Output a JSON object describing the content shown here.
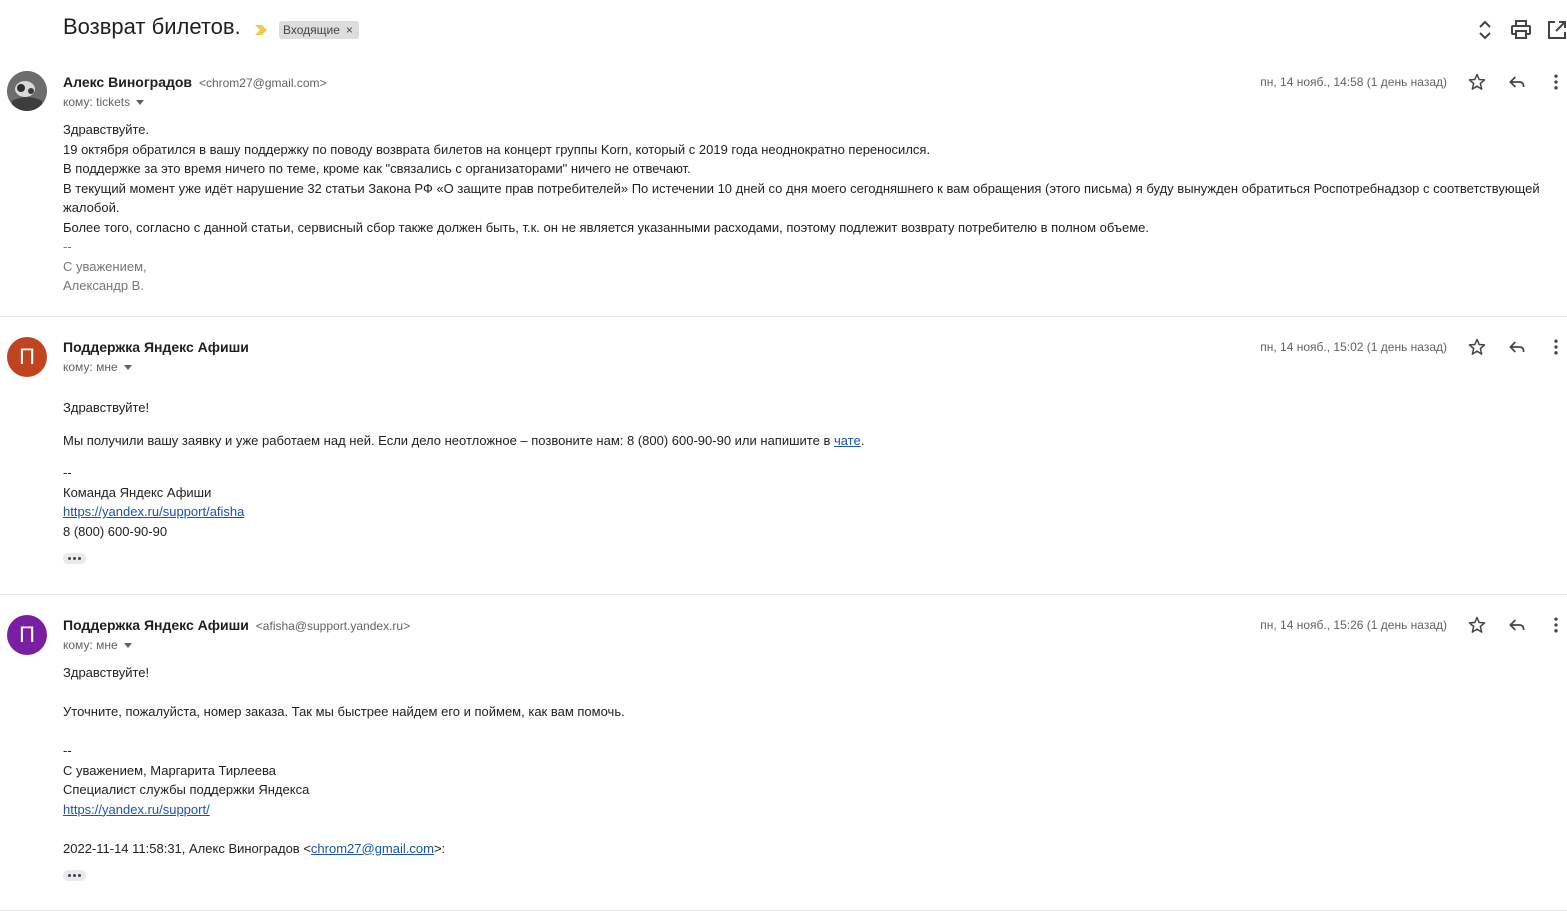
{
  "thread": {
    "subject": "Возврат билетов.",
    "label": "Входящие",
    "label_remove": "×",
    "important_color": "#f2c94c"
  },
  "messages": [
    {
      "sender_name": "Алекс Виноградов",
      "sender_email": "<chrom27@gmail.com>",
      "to": "кому: tickets",
      "date": "пн, 14 нояб., 14:58 (1 день назад)",
      "avatar_type": "photo",
      "body": [
        "Здравствуйте.",
        "19 октября обратился в вашу поддержку по поводу возврата билетов на концерт группы Korn, который с 2019 года неоднократно переносился.",
        "В поддержке за это время ничего по теме, кроме как \"связались с организаторами\" ничего не отвечают.",
        "В текущий момент уже идёт нарушение 32 статьи Закона РФ «О защите прав потребителей» По истечении 10 дней со дня моего сегодняшнего к вам обращения (этого письма) я буду вынужден обратиться Роспотребнадзор с соответствующей жалобой.",
        "Более того, согласно с данной статьи, сервисный сбор также должен быть, т.к. он не является указанными расходами, поэтому подлежит возврату потребителю в полном объеме."
      ],
      "signature": [
        "--",
        "С уважением,",
        "Александр В."
      ]
    },
    {
      "sender_name": "Поддержка Яндекс Афиши",
      "sender_email": "",
      "to": "кому: мне",
      "date": "пн, 14 нояб., 15:02 (1 день назад)",
      "avatar_letter": "П",
      "avatar_color": "#c0441e",
      "greeting": "Здравствуйте!",
      "text": "Мы получили вашу заявку и уже работаем над ней. Если дело неотложное – позвоните нам: 8 (800) 600-90-90 или напишите в ",
      "chat_link": "чате",
      "text_end": ".",
      "sig_dash": "--",
      "team": "Команда Яндекс Афиши",
      "link": "https://yandex.ru/support/afisha",
      "phone": "8 (800) 600-90-90"
    },
    {
      "sender_name": "Поддержка Яндекс Афиши",
      "sender_email": "<afisha@support.yandex.ru>",
      "to": "кому: мне",
      "date": "пн, 14 нояб., 15:26 (1 день назад)",
      "avatar_letter": "П",
      "avatar_color": "#7b1fa2",
      "greeting": "Здравствуйте!",
      "text": "Уточните, пожалуйста, номер заказа. Так мы быстрее найдем его и поймем, как вам помочь.",
      "sig_dash": "--",
      "regards": "С уважением, Маргарита Тирлеева",
      "role": "Специалист службы поддержки Яндекса",
      "link": "https://yandex.ru/support/",
      "quote_prefix": "2022-11-14 11:58:31, Алекс Виноградов <",
      "quote_email": "chrom27@gmail.com",
      "quote_suffix": ">:"
    }
  ],
  "icons": {
    "header": [
      "expand-collapse-icon",
      "print-icon",
      "open-new-window-icon"
    ],
    "message": [
      "star-icon",
      "reply-icon",
      "more-vert-icon"
    ]
  }
}
